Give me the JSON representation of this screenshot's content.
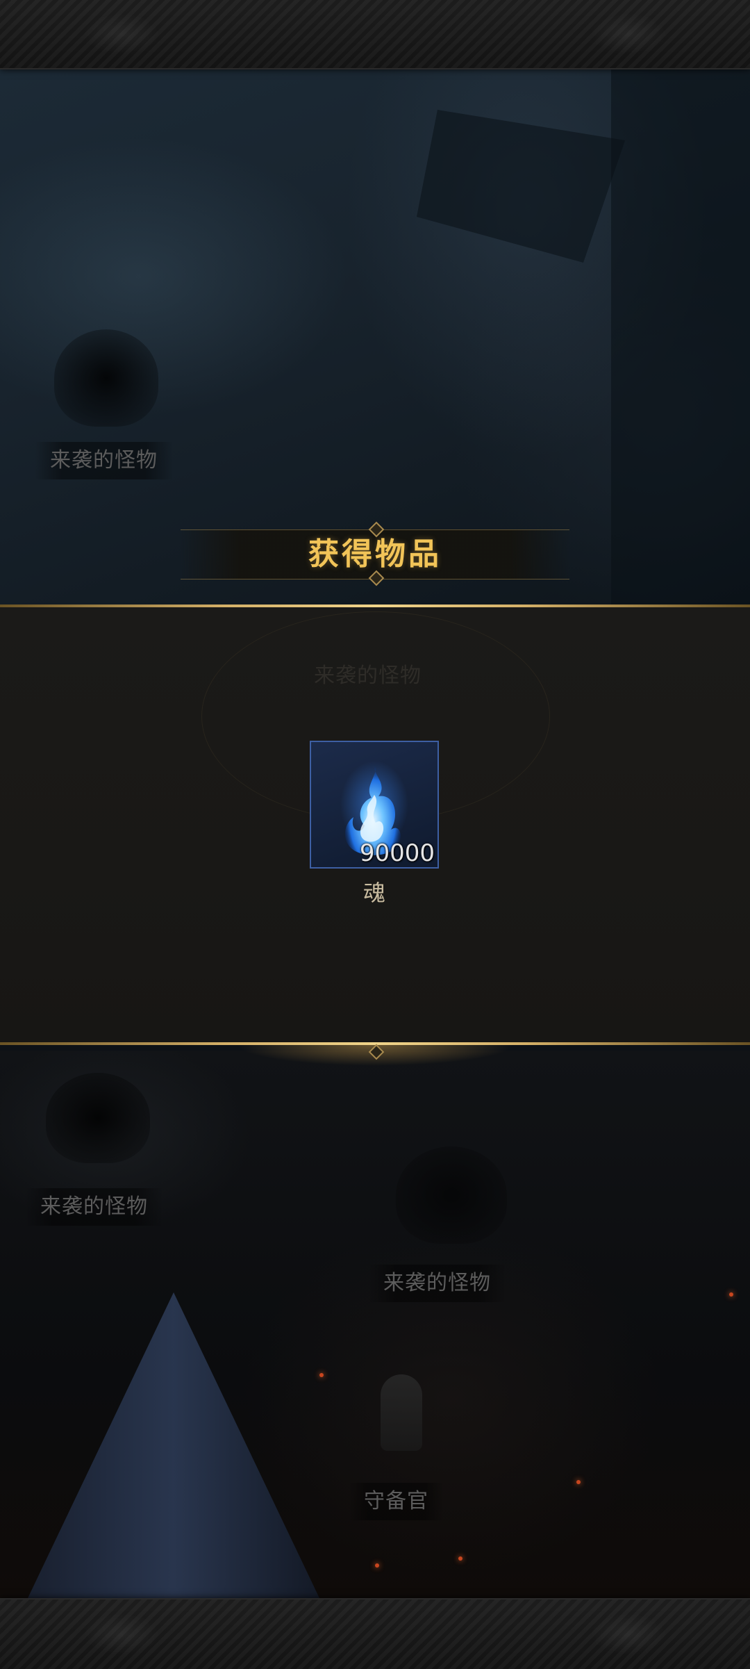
{
  "dialog": {
    "title": "获得物品"
  },
  "reward": {
    "icon": "blue-soul-flame-icon",
    "count": "90000",
    "name": "魂"
  },
  "scene": {
    "monster_label": "来袭的怪物",
    "guard_label": "守备官"
  },
  "colors": {
    "title_gold": "#f2c458",
    "frame_blue": "#3d5fa3",
    "panel_bg": "#1b1a18"
  }
}
